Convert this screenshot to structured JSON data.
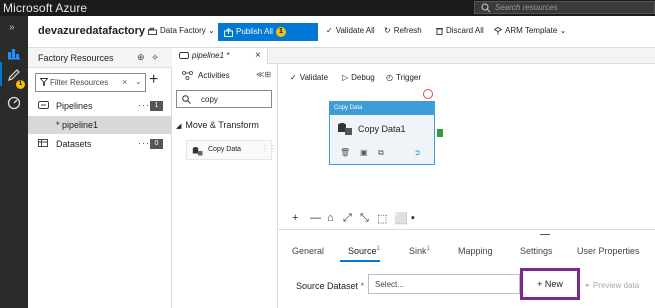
{
  "app": {
    "brand": "Microsoft Azure",
    "search_placeholder": "Search resources"
  },
  "rail": {
    "expand_glyph": "»",
    "badge_count": "1"
  },
  "toolbar": {
    "factory_name": "devazuredatafactory",
    "data_factory_label": "Data Factory",
    "publish_label": "Publish All",
    "publish_badge": "1",
    "validate_all_label": "Validate All",
    "refresh_label": "Refresh",
    "discard_all_label": "Discard All",
    "arm_template_label": "ARM Template"
  },
  "resources": {
    "title": "Factory Resources",
    "filter_placeholder": "Filter Resources",
    "add_glyph": "+",
    "pipelines_label": "Pipelines",
    "pipelines_count": "1",
    "pipeline_item": "* pipeline1",
    "datasets_label": "Datasets",
    "datasets_count": "0",
    "more_glyph": "···"
  },
  "tabs": {
    "pipeline_tab": "pipeline1 *"
  },
  "activities": {
    "title": "Activities",
    "search_value": "copy",
    "group_label": "Move & Transform",
    "item_label": "Copy Data"
  },
  "canvas": {
    "validate_label": "Validate",
    "debug_label": "Debug",
    "trigger_label": "Trigger",
    "node_header": "Copy Data",
    "node_name": "Copy Data1"
  },
  "zoom_tools": [
    "+",
    "—",
    "⌂",
    "⤢",
    "⤡",
    "⬚",
    "⬜",
    "▪"
  ],
  "bottom": {
    "tabs": [
      {
        "label": "General"
      },
      {
        "label": "Source",
        "sup": "1"
      },
      {
        "label": "Sink",
        "sup": "1"
      },
      {
        "label": "Mapping"
      },
      {
        "label": "Settings"
      },
      {
        "label": "User Properties"
      }
    ],
    "source_dataset_label": "Source Dataset",
    "required_mark": "*",
    "select_placeholder": "Select...",
    "new_label": "+ New",
    "preview_label": "Preview data"
  },
  "colors": {
    "accent": "#0078d4",
    "highlight_border": "#7a2a8a",
    "node_header": "#3c9dd8",
    "warning_badge": "#f3c300"
  }
}
